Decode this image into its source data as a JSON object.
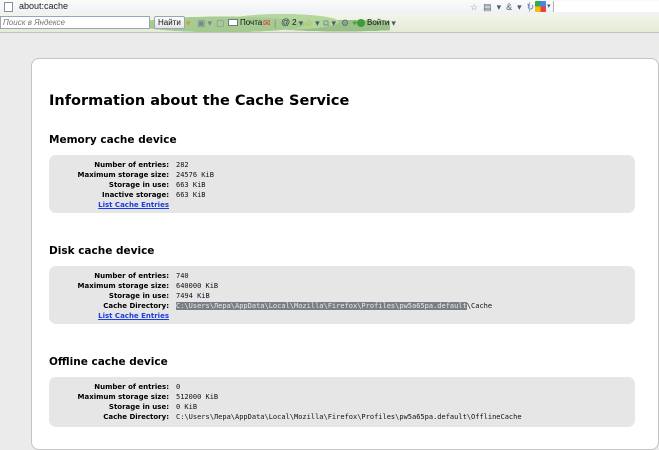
{
  "browser": {
    "url": "about:cache",
    "yandex_search_placeholder": "Поиск в Яндексе",
    "toolbar": {
      "find_label": "Найти",
      "mail_label": "Почта",
      "count_label": "2",
      "login_label": "Войти"
    }
  },
  "page": {
    "title": "Information about the Cache Service",
    "sections": [
      {
        "title": "Memory cache device",
        "rows": [
          {
            "label": "Number of entries:",
            "value": "282"
          },
          {
            "label": "Maximum storage size:",
            "value": "24576 KiB"
          },
          {
            "label": "Storage in use:",
            "value": "663 KiB"
          },
          {
            "label": "Inactive storage:",
            "value": "663 KiB"
          }
        ],
        "link": "List Cache Entries"
      },
      {
        "title": "Disk cache device",
        "rows": [
          {
            "label": "Number of entries:",
            "value": "740"
          },
          {
            "label": "Maximum storage size:",
            "value": "640000 KiB"
          },
          {
            "label": "Storage in use:",
            "value": "7494 KiB"
          }
        ],
        "directory": {
          "label": "Cache Directory:",
          "selected_part": "C:\\Users\\Лера\\AppData\\Local\\Mozilla\\Firefox\\Profiles\\pw5a65pa.default",
          "rest": "\\Cache"
        },
        "link": "List Cache Entries"
      },
      {
        "title": "Offline cache device",
        "rows": [
          {
            "label": "Number of entries:",
            "value": "0"
          },
          {
            "label": "Maximum storage size:",
            "value": "512000 KiB"
          },
          {
            "label": "Storage in use:",
            "value": "0 KiB"
          },
          {
            "label": "Cache Directory:",
            "value": "C:\\Users\\Лера\\AppData\\Local\\Mozilla\\Firefox\\Profiles\\pw5a65pa.default\\OfflineCache"
          }
        ]
      }
    ]
  }
}
